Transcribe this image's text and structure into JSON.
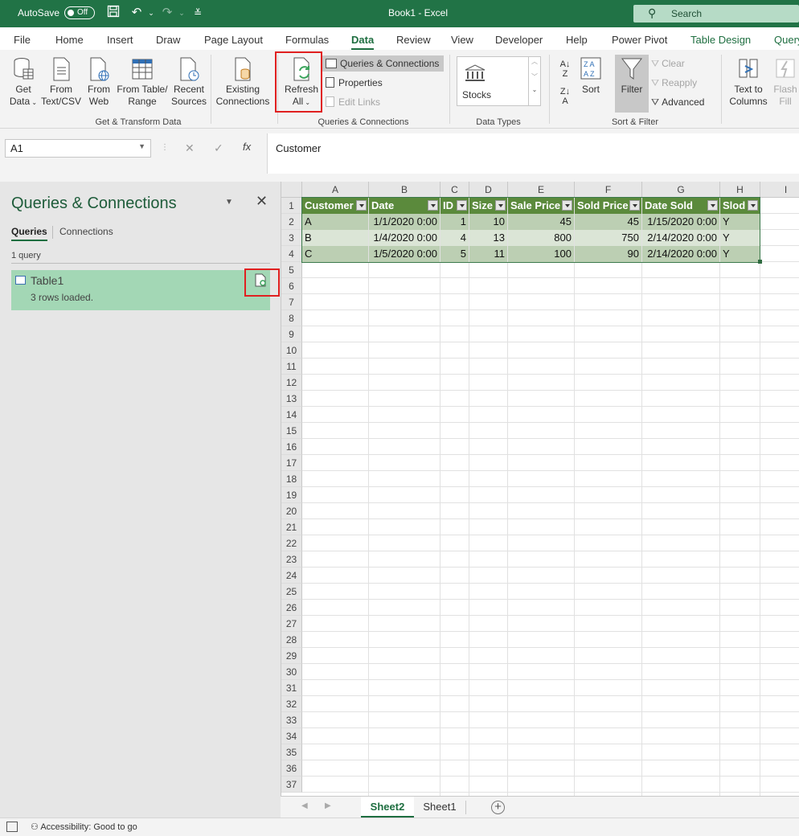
{
  "titlebar": {
    "autosave_label": "AutoSave",
    "autosave_state": "Off",
    "window_title": "Book1  -  Excel",
    "search_placeholder": "Search",
    "color": "#217346"
  },
  "tabs": [
    "File",
    "Home",
    "Insert",
    "Draw",
    "Page Layout",
    "Formulas",
    "Data",
    "Review",
    "View",
    "Developer",
    "Help",
    "Power Pivot",
    "Table Design",
    "Query"
  ],
  "active_tab": "Data",
  "ribbon": {
    "get_data": [
      "Get",
      "Data"
    ],
    "from_text": [
      "From",
      "Text/CSV"
    ],
    "from_web": [
      "From",
      "Web"
    ],
    "from_table": [
      "From Table/",
      "Range"
    ],
    "recent_sources": [
      "Recent",
      "Sources"
    ],
    "existing_connections": [
      "Existing",
      "Connections"
    ],
    "group_get_transform": "Get & Transform Data",
    "refresh_all": [
      "Refresh",
      "All"
    ],
    "queries_connections": "Queries & Connections",
    "properties": "Properties",
    "edit_links": "Edit Links",
    "group_queries": "Queries & Connections",
    "stocks": "Stocks",
    "group_data_types": "Data Types",
    "sort": "Sort",
    "filter": "Filter",
    "clear": "Clear",
    "reapply": "Reapply",
    "advanced": "Advanced",
    "group_sort_filter": "Sort & Filter",
    "text_to_columns": [
      "Text to",
      "Columns"
    ],
    "flash_fill": [
      "Flash",
      "Fill"
    ]
  },
  "formula_bar": {
    "name_box": "A1",
    "content": "Customer",
    "fx": "fx"
  },
  "queries_pane": {
    "title": "Queries & Connections",
    "tab_queries": "Queries",
    "tab_connections": "Connections",
    "count": "1 query",
    "item_name": "Table1",
    "item_status": "3 rows loaded."
  },
  "grid": {
    "columns": [
      "A",
      "B",
      "C",
      "D",
      "E",
      "F",
      "G",
      "H",
      "I"
    ],
    "rows": [
      "1",
      "2",
      "3",
      "4",
      "5",
      "6",
      "7",
      "8",
      "9",
      "10",
      "11",
      "12",
      "13",
      "14",
      "15",
      "16",
      "17",
      "18",
      "19",
      "20",
      "21",
      "22",
      "23",
      "24",
      "25",
      "26",
      "27",
      "28",
      "29",
      "30",
      "31",
      "32",
      "33",
      "34",
      "35",
      "36",
      "37"
    ],
    "table_headers": [
      "Customer",
      "Date",
      "ID",
      "Size",
      "Sale Price",
      "Sold Price",
      "Date Sold",
      "Slod"
    ],
    "table_rows": [
      [
        "A",
        "1/1/2020 0:00",
        "1",
        "10",
        "45",
        "45",
        "1/15/2020 0:00",
        "Y"
      ],
      [
        "B",
        "1/4/2020 0:00",
        "4",
        "13",
        "800",
        "750",
        "2/14/2020 0:00",
        "Y"
      ],
      [
        "C",
        "1/5/2020 0:00",
        "5",
        "11",
        "100",
        "90",
        "2/14/2020 0:00",
        "Y"
      ]
    ]
  },
  "sheets": {
    "tabs": [
      "Sheet2",
      "Sheet1"
    ],
    "active": "Sheet2"
  },
  "status": {
    "accessibility": "Accessibility: Good to go"
  }
}
